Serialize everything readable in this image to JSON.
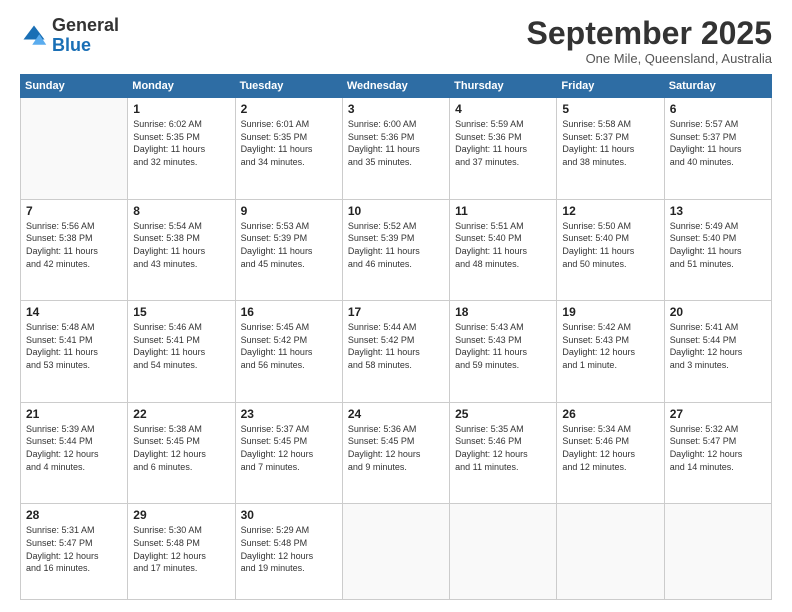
{
  "logo": {
    "general": "General",
    "blue": "Blue"
  },
  "header": {
    "month": "September 2025",
    "location": "One Mile, Queensland, Australia"
  },
  "weekdays": [
    "Sunday",
    "Monday",
    "Tuesday",
    "Wednesday",
    "Thursday",
    "Friday",
    "Saturday"
  ],
  "weeks": [
    [
      {
        "day": "",
        "info": ""
      },
      {
        "day": "1",
        "info": "Sunrise: 6:02 AM\nSunset: 5:35 PM\nDaylight: 11 hours\nand 32 minutes."
      },
      {
        "day": "2",
        "info": "Sunrise: 6:01 AM\nSunset: 5:35 PM\nDaylight: 11 hours\nand 34 minutes."
      },
      {
        "day": "3",
        "info": "Sunrise: 6:00 AM\nSunset: 5:36 PM\nDaylight: 11 hours\nand 35 minutes."
      },
      {
        "day": "4",
        "info": "Sunrise: 5:59 AM\nSunset: 5:36 PM\nDaylight: 11 hours\nand 37 minutes."
      },
      {
        "day": "5",
        "info": "Sunrise: 5:58 AM\nSunset: 5:37 PM\nDaylight: 11 hours\nand 38 minutes."
      },
      {
        "day": "6",
        "info": "Sunrise: 5:57 AM\nSunset: 5:37 PM\nDaylight: 11 hours\nand 40 minutes."
      }
    ],
    [
      {
        "day": "7",
        "info": "Sunrise: 5:56 AM\nSunset: 5:38 PM\nDaylight: 11 hours\nand 42 minutes."
      },
      {
        "day": "8",
        "info": "Sunrise: 5:54 AM\nSunset: 5:38 PM\nDaylight: 11 hours\nand 43 minutes."
      },
      {
        "day": "9",
        "info": "Sunrise: 5:53 AM\nSunset: 5:39 PM\nDaylight: 11 hours\nand 45 minutes."
      },
      {
        "day": "10",
        "info": "Sunrise: 5:52 AM\nSunset: 5:39 PM\nDaylight: 11 hours\nand 46 minutes."
      },
      {
        "day": "11",
        "info": "Sunrise: 5:51 AM\nSunset: 5:40 PM\nDaylight: 11 hours\nand 48 minutes."
      },
      {
        "day": "12",
        "info": "Sunrise: 5:50 AM\nSunset: 5:40 PM\nDaylight: 11 hours\nand 50 minutes."
      },
      {
        "day": "13",
        "info": "Sunrise: 5:49 AM\nSunset: 5:40 PM\nDaylight: 11 hours\nand 51 minutes."
      }
    ],
    [
      {
        "day": "14",
        "info": "Sunrise: 5:48 AM\nSunset: 5:41 PM\nDaylight: 11 hours\nand 53 minutes."
      },
      {
        "day": "15",
        "info": "Sunrise: 5:46 AM\nSunset: 5:41 PM\nDaylight: 11 hours\nand 54 minutes."
      },
      {
        "day": "16",
        "info": "Sunrise: 5:45 AM\nSunset: 5:42 PM\nDaylight: 11 hours\nand 56 minutes."
      },
      {
        "day": "17",
        "info": "Sunrise: 5:44 AM\nSunset: 5:42 PM\nDaylight: 11 hours\nand 58 minutes."
      },
      {
        "day": "18",
        "info": "Sunrise: 5:43 AM\nSunset: 5:43 PM\nDaylight: 11 hours\nand 59 minutes."
      },
      {
        "day": "19",
        "info": "Sunrise: 5:42 AM\nSunset: 5:43 PM\nDaylight: 12 hours\nand 1 minute."
      },
      {
        "day": "20",
        "info": "Sunrise: 5:41 AM\nSunset: 5:44 PM\nDaylight: 12 hours\nand 3 minutes."
      }
    ],
    [
      {
        "day": "21",
        "info": "Sunrise: 5:39 AM\nSunset: 5:44 PM\nDaylight: 12 hours\nand 4 minutes."
      },
      {
        "day": "22",
        "info": "Sunrise: 5:38 AM\nSunset: 5:45 PM\nDaylight: 12 hours\nand 6 minutes."
      },
      {
        "day": "23",
        "info": "Sunrise: 5:37 AM\nSunset: 5:45 PM\nDaylight: 12 hours\nand 7 minutes."
      },
      {
        "day": "24",
        "info": "Sunrise: 5:36 AM\nSunset: 5:45 PM\nDaylight: 12 hours\nand 9 minutes."
      },
      {
        "day": "25",
        "info": "Sunrise: 5:35 AM\nSunset: 5:46 PM\nDaylight: 12 hours\nand 11 minutes."
      },
      {
        "day": "26",
        "info": "Sunrise: 5:34 AM\nSunset: 5:46 PM\nDaylight: 12 hours\nand 12 minutes."
      },
      {
        "day": "27",
        "info": "Sunrise: 5:32 AM\nSunset: 5:47 PM\nDaylight: 12 hours\nand 14 minutes."
      }
    ],
    [
      {
        "day": "28",
        "info": "Sunrise: 5:31 AM\nSunset: 5:47 PM\nDaylight: 12 hours\nand 16 minutes."
      },
      {
        "day": "29",
        "info": "Sunrise: 5:30 AM\nSunset: 5:48 PM\nDaylight: 12 hours\nand 17 minutes."
      },
      {
        "day": "30",
        "info": "Sunrise: 5:29 AM\nSunset: 5:48 PM\nDaylight: 12 hours\nand 19 minutes."
      },
      {
        "day": "",
        "info": ""
      },
      {
        "day": "",
        "info": ""
      },
      {
        "day": "",
        "info": ""
      },
      {
        "day": "",
        "info": ""
      }
    ]
  ]
}
